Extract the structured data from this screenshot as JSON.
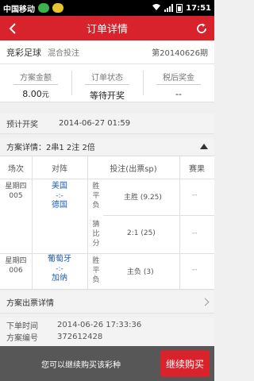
{
  "statusbar": {
    "carrier": "中国移动",
    "time": "17:51"
  },
  "header": {
    "title": "订单详情"
  },
  "game": {
    "name": "竞彩足球",
    "type": "混合投注",
    "issue": "第20140626期"
  },
  "summary": [
    {
      "label": "方案金额",
      "value": "8.00",
      "unit": "元"
    },
    {
      "label": "订单状态",
      "value": "等待开奖",
      "unit": ""
    },
    {
      "label": "税后奖金",
      "value": "--",
      "unit": ""
    }
  ],
  "start": {
    "label": "预计开奖",
    "value": "2014-06-27 01:59"
  },
  "detail": {
    "title": "方案详情：2串1  2注  2倍"
  },
  "table": {
    "headers": [
      "场次",
      "对阵",
      "投注(出票sp)",
      "赛果"
    ],
    "matches": [
      {
        "day": "星期四",
        "no": "005",
        "home": "美国",
        "vs": "-:-",
        "away": "德国",
        "play1": [
          "胜",
          "平",
          "负"
        ],
        "pick1": "主胜 (9.25)",
        "result1": "--",
        "play2": [
          "猜",
          "比",
          "分"
        ],
        "pick2": "2:1 (25)",
        "result2": "--"
      },
      {
        "day": "星期四",
        "no": "006",
        "home": "葡萄牙",
        "vs": "-:-",
        "away": "加纳",
        "play1": [
          "胜",
          "平",
          "负"
        ],
        "pick1": "主负 (3)",
        "result1": "--"
      }
    ]
  },
  "ticket_link": "方案出票详情",
  "meta": {
    "order_time_label": "下单时间",
    "order_time": "2014-06-26 17:33:36",
    "order_no_label": "方案编号",
    "order_no": "372612428"
  },
  "footer": {
    "hint": "您可以继续购买该彩种",
    "button": "继续购买"
  },
  "colors": {
    "accent": "#d8232d",
    "team": "#1f5fb0"
  }
}
